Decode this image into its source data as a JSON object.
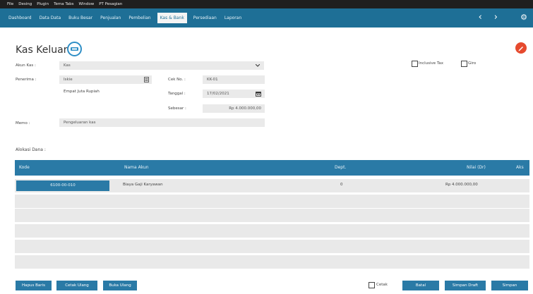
{
  "menubar": {
    "items": [
      "File",
      "Desing",
      "Plugin",
      "Tema Tabs",
      "Window",
      "PT Pesagian"
    ]
  },
  "navbar": {
    "tabs": [
      "Dashboard",
      "Data Data",
      "Buku Besar",
      "Penjualan",
      "Pembelian",
      "Kas & Bank",
      "Persediaan",
      "Laporan"
    ],
    "active": "Kas & Bank",
    "prev_icon": "‹",
    "next_icon": "›",
    "gear_icon": "⚙"
  },
  "form": {
    "title": "Kas Keluar",
    "title_icon": "pay-icon",
    "akun_kas_label": "Akun Kas :",
    "akun_kas_value": "Kas",
    "penerima_label": "Penerima :",
    "penerima_value": "Iskie",
    "terbilang": "Empat Juta Rupiah",
    "cek_no_label": "Cek No. :",
    "cek_no_value": "KK-01",
    "tanggal_label": "Tanggal :",
    "tanggal_value": "17/02/2021",
    "sebesar_label": "Sebesar :",
    "sebesar_value": "Rp 4.000.000,00",
    "memo_label": "Memo :",
    "memo_value": "Pengeluaran kas",
    "inclusive_tax": "Inclusive Tax",
    "giro": "Giro"
  },
  "alokasi": {
    "label": "Alokasi Dana :",
    "columns": [
      "Kode",
      "Nama Akun",
      "Dept.",
      "Nilai (Dr)",
      "Aks"
    ],
    "rows": [
      {
        "kode": "6100-00-010",
        "nama": "Biaya Gaji Karyawan",
        "dept": "0",
        "nilai": "Rp 4.000.000,00"
      }
    ]
  },
  "footer": {
    "hapus_baris": "Hapus Baris",
    "cetak_ulang": "Cetak Ulang",
    "buka_ulang": "Buka Ulang",
    "cetak_chk": "Cetak",
    "batal": "Batal",
    "simpan_draft": "Simpan Draft",
    "simpan": "Simpan"
  }
}
